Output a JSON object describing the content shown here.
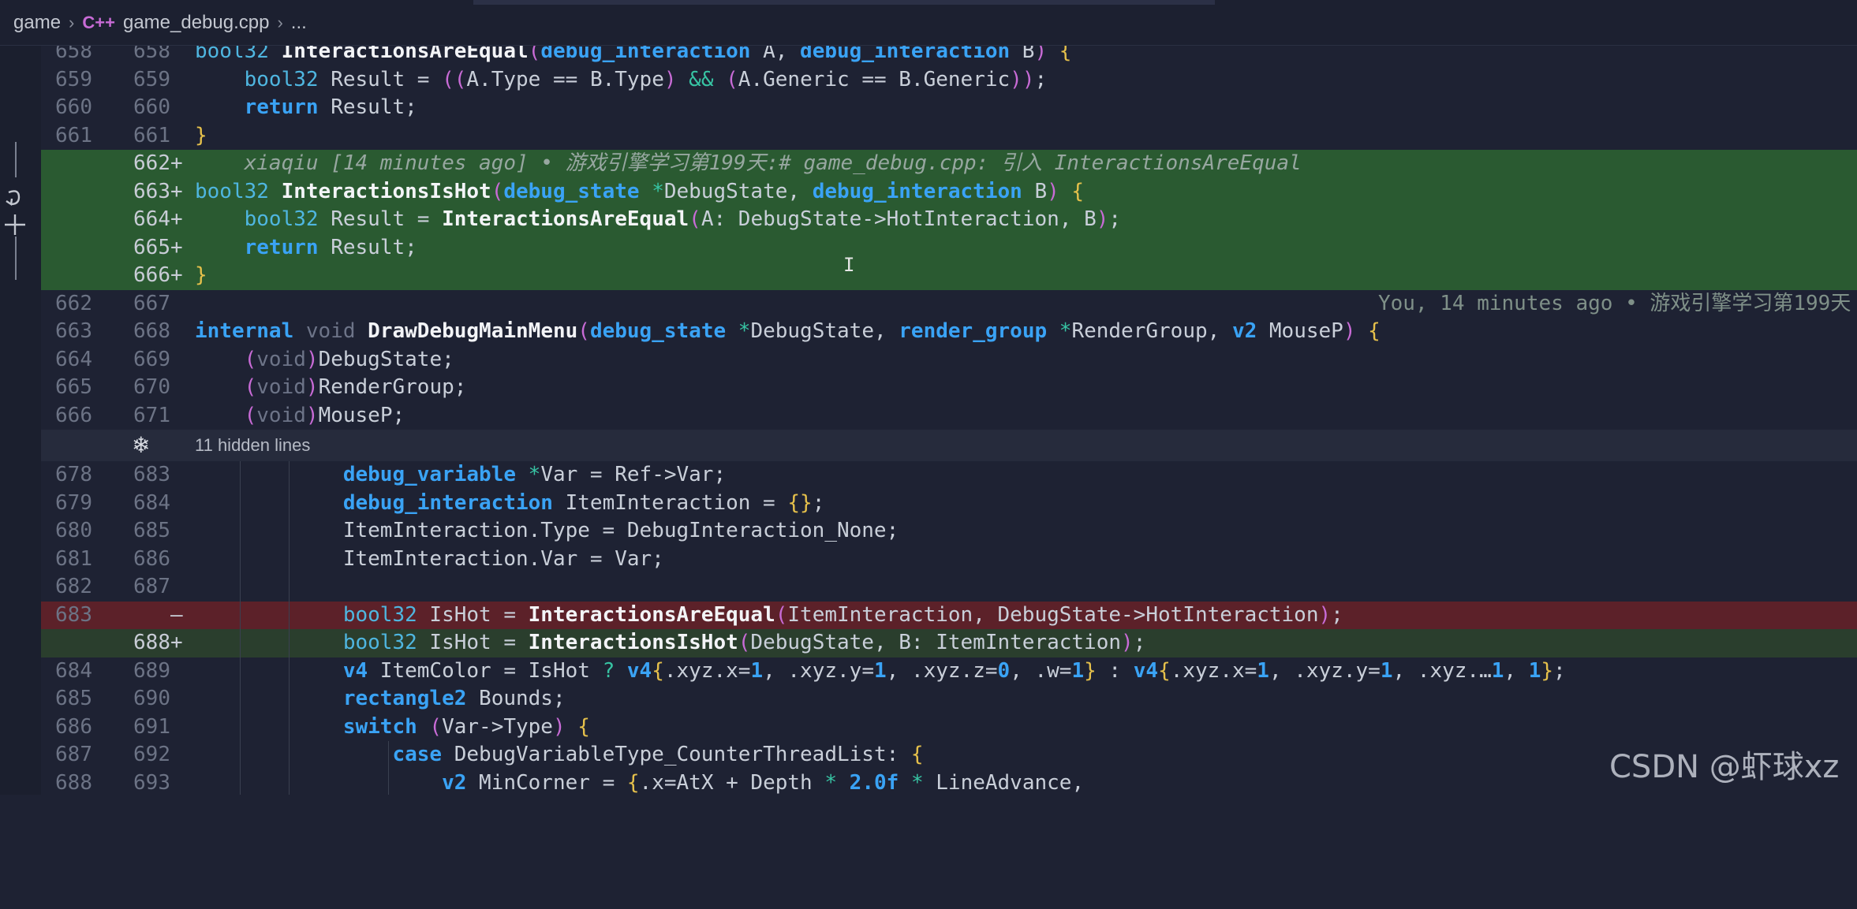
{
  "breadcrumb": {
    "folder": "game",
    "file_icon": "C++",
    "file": "game_debug.cpp",
    "more": "..."
  },
  "left_controls": {
    "revert_icon": "undo-icon",
    "add_icon": "plus-icon"
  },
  "hidden_lines": {
    "icon": "unfold-icon",
    "label": "11 hidden lines"
  },
  "lines": [
    {
      "old": "658",
      "new": "658",
      "marker": "",
      "kind": "ctx",
      "code": "bool32 InteractionsAreEqual(debug_interaction A, debug_interaction B) {"
    },
    {
      "old": "659",
      "new": "659",
      "marker": "",
      "kind": "ctx",
      "code": "    bool32 Result = ((A.Type == B.Type) && (A.Generic == B.Generic));"
    },
    {
      "old": "660",
      "new": "660",
      "marker": "",
      "kind": "ctx",
      "code": "    return Result;"
    },
    {
      "old": "661",
      "new": "661",
      "marker": "",
      "kind": "ctx",
      "code": "}"
    },
    {
      "old": "",
      "new": "662",
      "marker": "+",
      "kind": "add",
      "code": "    xiaqiu [14 minutes ago] • 游戏引擎学习第199天:# game_debug.cpp: 引入 InteractionsAreEqual",
      "blame_right": "You, 14 minutes ago • 游戏引擎学习第199天"
    },
    {
      "old": "",
      "new": "663",
      "marker": "+",
      "kind": "add",
      "code": "bool32 InteractionsIsHot(debug_state *DebugState, debug_interaction B) {"
    },
    {
      "old": "",
      "new": "664",
      "marker": "+",
      "kind": "add",
      "code": "    bool32 Result = InteractionsAreEqual(A: DebugState->HotInteraction, B);"
    },
    {
      "old": "",
      "new": "665",
      "marker": "+",
      "kind": "add",
      "code": "    return Result;"
    },
    {
      "old": "",
      "new": "666",
      "marker": "+",
      "kind": "add",
      "code": "}"
    },
    {
      "old": "662",
      "new": "667",
      "marker": "",
      "kind": "ctx",
      "code": ""
    },
    {
      "old": "663",
      "new": "668",
      "marker": "",
      "kind": "ctx",
      "code": "internal void DrawDebugMainMenu(debug_state *DebugState, render_group *RenderGroup, v2 MouseP) {"
    },
    {
      "old": "664",
      "new": "669",
      "marker": "",
      "kind": "ctx",
      "code": "    (void)DebugState;"
    },
    {
      "old": "665",
      "new": "670",
      "marker": "",
      "kind": "ctx",
      "code": "    (void)RenderGroup;"
    },
    {
      "old": "666",
      "new": "671",
      "marker": "",
      "kind": "ctx",
      "code": "    (void)MouseP;"
    },
    {
      "old": "678",
      "new": "683",
      "marker": "",
      "kind": "ctx",
      "code": "            debug_variable *Var = Ref->Var;"
    },
    {
      "old": "679",
      "new": "684",
      "marker": "",
      "kind": "ctx",
      "code": "            debug_interaction ItemInteraction = {};"
    },
    {
      "old": "680",
      "new": "685",
      "marker": "",
      "kind": "ctx",
      "code": "            ItemInteraction.Type = DebugInteraction_None;"
    },
    {
      "old": "681",
      "new": "686",
      "marker": "",
      "kind": "ctx",
      "code": "            ItemInteraction.Var = Var;"
    },
    {
      "old": "682",
      "new": "687",
      "marker": "",
      "kind": "ctx",
      "code": ""
    },
    {
      "old": "683",
      "new": "",
      "marker": "—",
      "kind": "del",
      "code": "            bool32 IsHot = InteractionsAreEqual(ItemInteraction, DebugState->HotInteraction);"
    },
    {
      "old": "",
      "new": "688",
      "marker": "+",
      "kind": "add2",
      "code": "            bool32 IsHot = InteractionsIsHot(DebugState, B: ItemInteraction);"
    },
    {
      "old": "684",
      "new": "689",
      "marker": "",
      "kind": "ctx",
      "code": "            v4 ItemColor = IsHot ? v4{.xyz.x=1, .xyz.y=1, .xyz.z=0, .w=1} : v4{.xyz.x=1, .xyz.y=1, .xyz.…1, 1};"
    },
    {
      "old": "685",
      "new": "690",
      "marker": "",
      "kind": "ctx",
      "code": "            rectangle2 Bounds;"
    },
    {
      "old": "686",
      "new": "691",
      "marker": "",
      "kind": "ctx",
      "code": "            switch (Var->Type) {"
    },
    {
      "old": "687",
      "new": "692",
      "marker": "",
      "kind": "ctx",
      "code": "                case DebugVariableType_CounterThreadList: {"
    },
    {
      "old": "688",
      "new": "693",
      "marker": "",
      "kind": "ctx",
      "code": "                    v2 MinCorner = {.x=AtX + Depth * 2.0f * LineAdvance,"
    }
  ],
  "watermark": "CSDN @虾球xz",
  "colors": {
    "background": "#1e2233",
    "added": "#2a5a31",
    "removed": "#5c2129",
    "keyword": "#3aa3f5"
  }
}
